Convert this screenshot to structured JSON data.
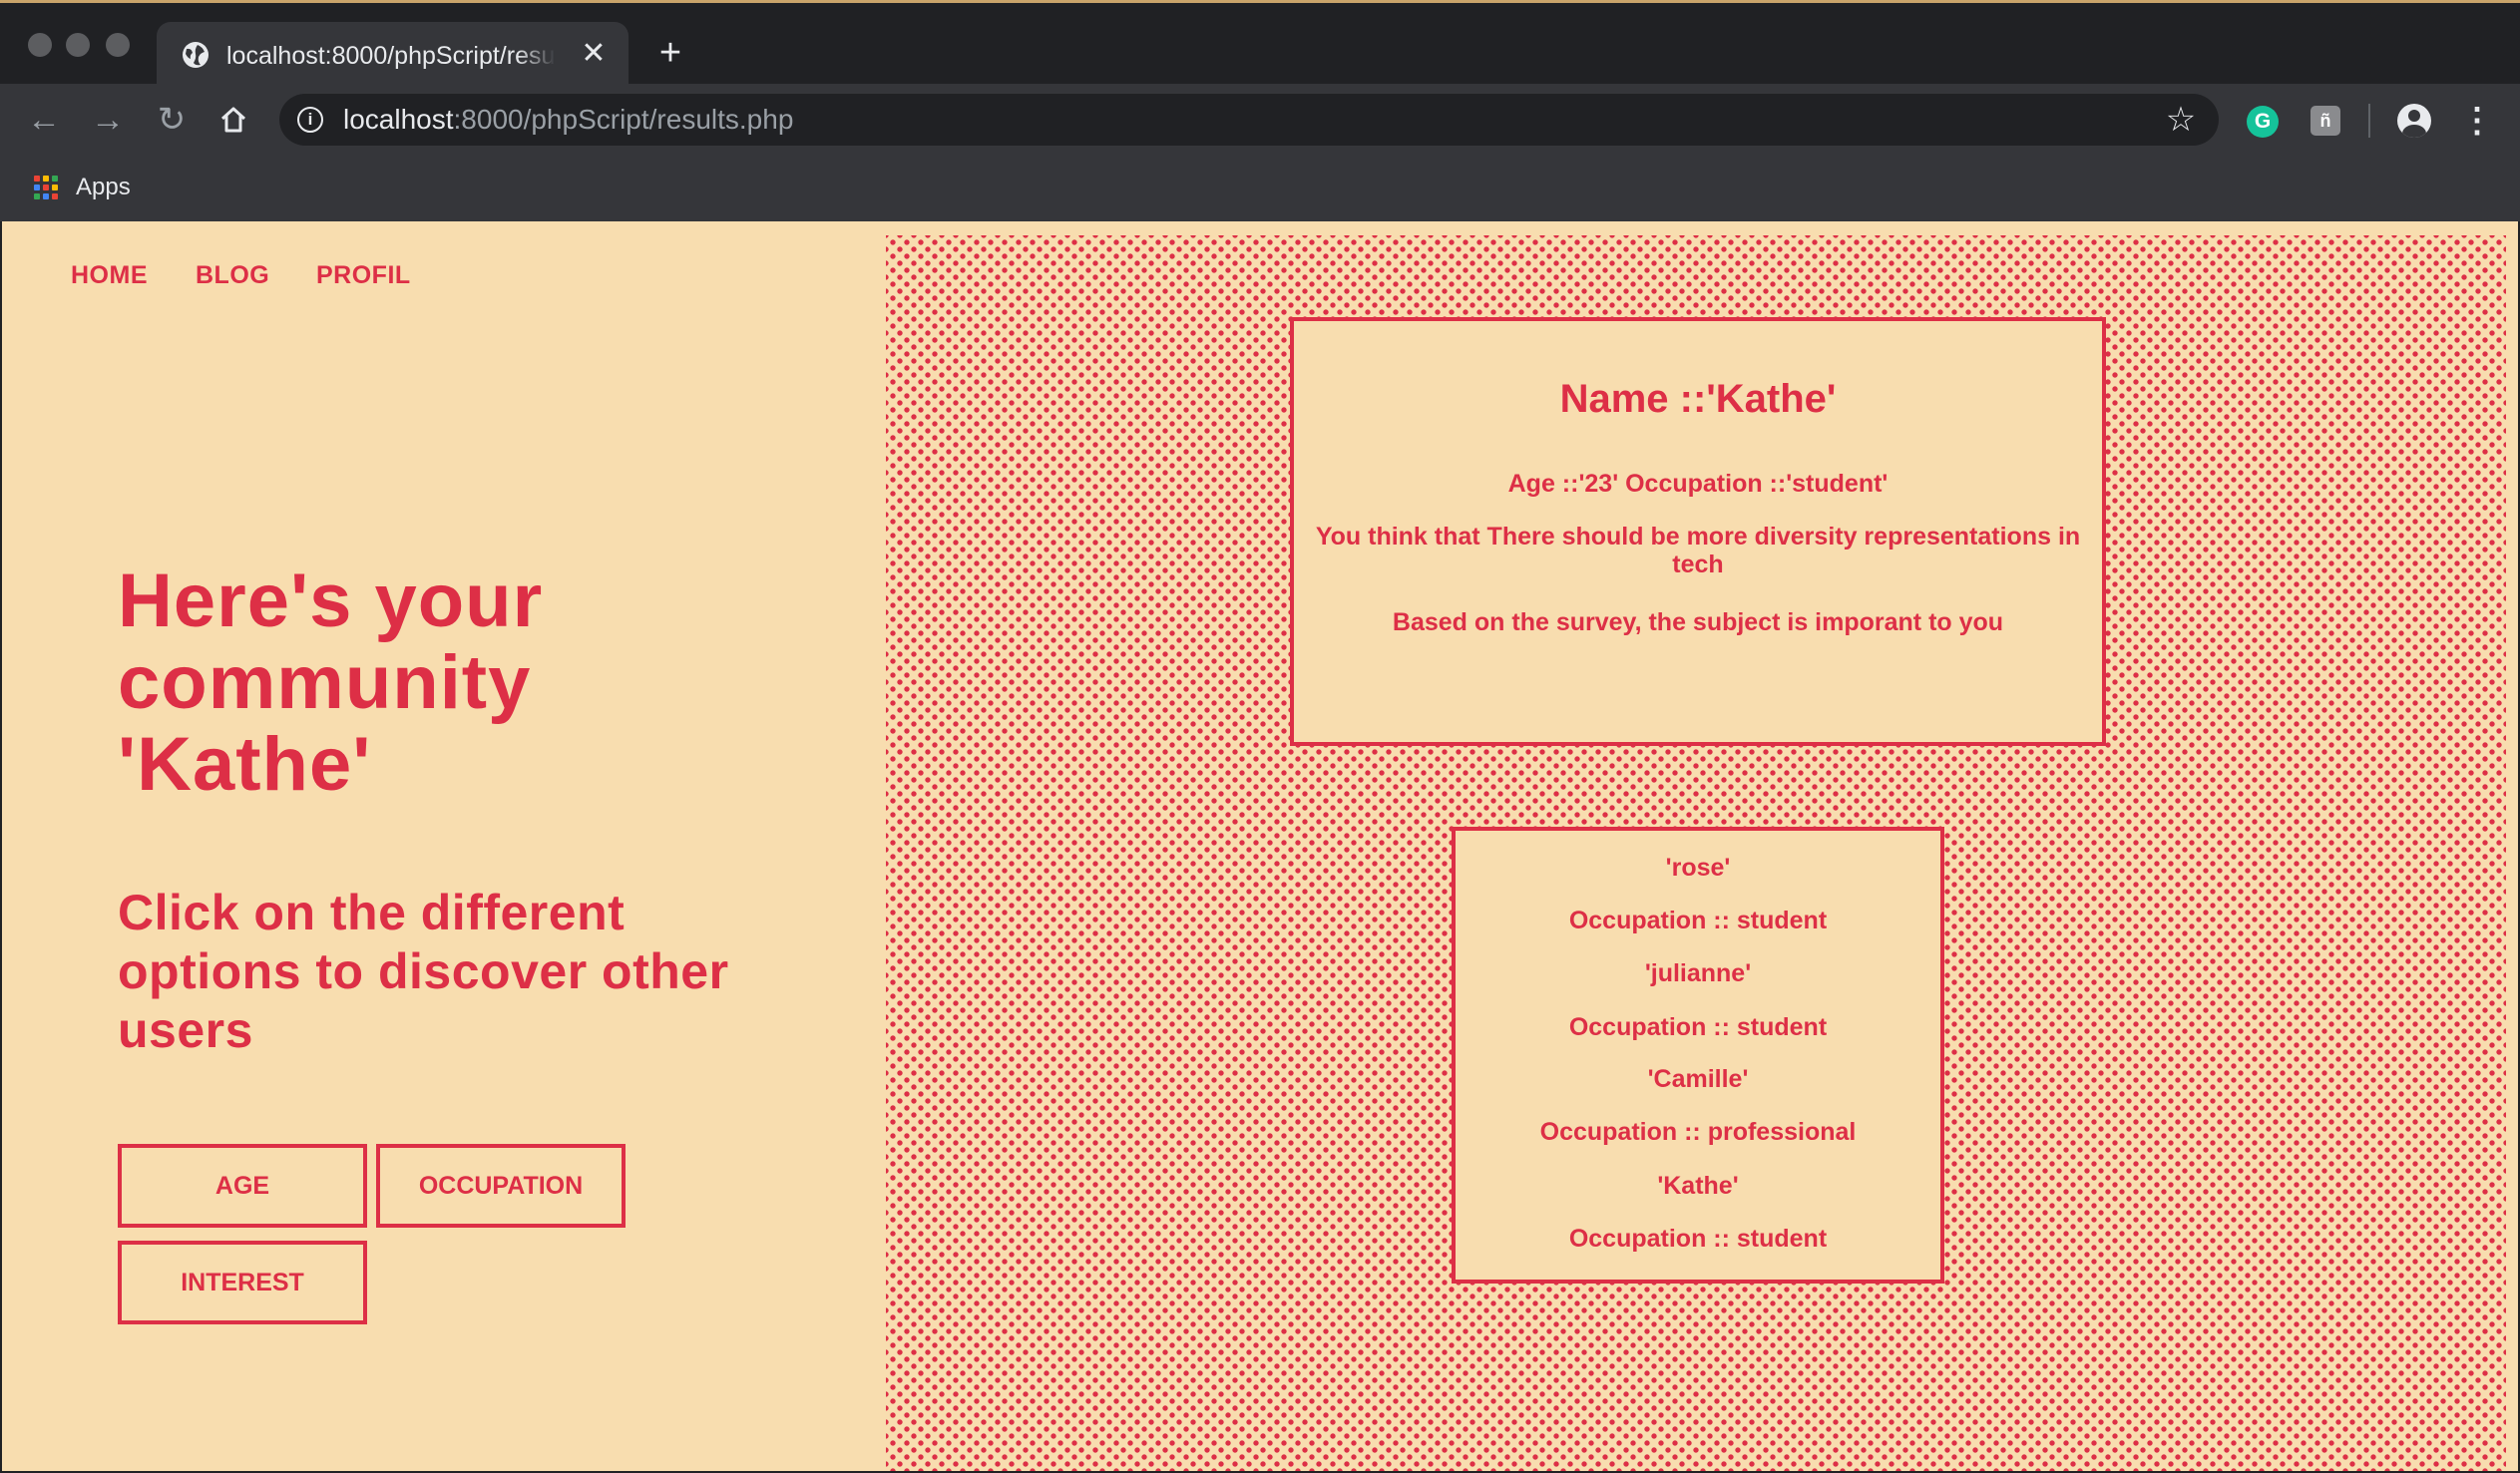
{
  "browser": {
    "tab_title": "localhost:8000/phpScript/results.php",
    "url_host": "localhost",
    "url_path": ":8000/phpScript/results.php",
    "bookmarks": [
      {
        "label": "Apps",
        "icon": "apps-grid-icon"
      }
    ],
    "icons": {
      "favicon": "globe-icon",
      "close": "close-icon",
      "new_tab": "plus-icon",
      "back": "back-arrow-icon",
      "forward": "forward-arrow-icon",
      "reload": "reload-icon",
      "home": "home-icon",
      "site_info": "info-icon",
      "bookmark_star": "star-icon",
      "extension_1": "grammarly-icon",
      "extension_2": "extension-icon",
      "profile": "profile-icon",
      "menu": "more-vert-icon"
    }
  },
  "site": {
    "nav": [
      {
        "label": "HOME"
      },
      {
        "label": "BLOG"
      },
      {
        "label": "PROFIL"
      }
    ],
    "hero_title": "Here's your community 'Kathe'",
    "hero_subtitle": "Click on the different options to discover other users",
    "filter_buttons": [
      {
        "label": "AGE"
      },
      {
        "label": "OCCUPATION"
      },
      {
        "label": "INTEREST"
      }
    ],
    "profile_card": {
      "name": "Name ::'Kathe'",
      "details": "Age ::'23' Occupation ::'student'",
      "opinion": "You think that There should be more diversity representations in tech",
      "importance": "Based on the survey, the subject is imporant to you"
    },
    "users": [
      {
        "name": "'rose'",
        "occupation": "Occupation :: student"
      },
      {
        "name": "'julianne'",
        "occupation": "Occupation :: student"
      },
      {
        "name": "'Camille'",
        "occupation": "Occupation :: professional"
      },
      {
        "name": "'Kathe'",
        "occupation": "Occupation :: student"
      }
    ]
  },
  "colors": {
    "accent": "#dd2f46",
    "page_background": "#f8ddaf",
    "chrome_dark": "#202124",
    "chrome_toolbar": "#35363a"
  }
}
